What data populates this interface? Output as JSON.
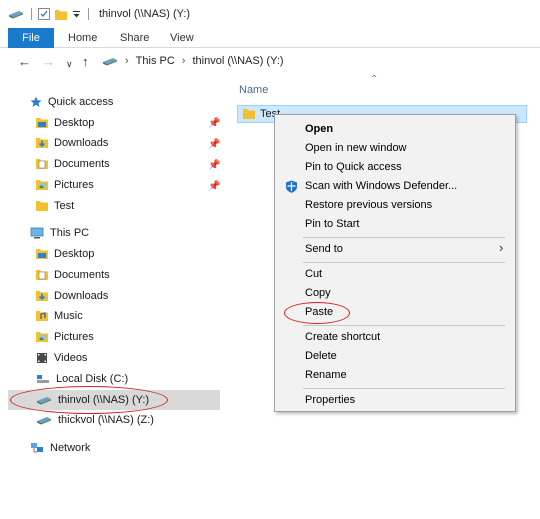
{
  "titlebar": {
    "title": "thinvol (\\\\NAS) (Y:)"
  },
  "ribbon": {
    "tabs": [
      "File",
      "Home",
      "Share",
      "View"
    ]
  },
  "address": {
    "crumbs": [
      "This PC",
      "thinvol (\\\\NAS) (Y:)"
    ]
  },
  "column": {
    "name_header": "Name"
  },
  "sidebar": {
    "quick_access": {
      "label": "Quick access",
      "items": [
        {
          "label": "Desktop",
          "icon": "desktop-folder-icon"
        },
        {
          "label": "Downloads",
          "icon": "downloads-folder-icon"
        },
        {
          "label": "Documents",
          "icon": "documents-folder-icon"
        },
        {
          "label": "Pictures",
          "icon": "pictures-folder-icon"
        },
        {
          "label": "Test",
          "icon": "folder-icon"
        }
      ]
    },
    "this_pc": {
      "label": "This PC",
      "items": [
        {
          "label": "Desktop"
        },
        {
          "label": "Documents"
        },
        {
          "label": "Downloads"
        },
        {
          "label": "Music"
        },
        {
          "label": "Pictures"
        },
        {
          "label": "Videos"
        },
        {
          "label": "Local Disk (C:)"
        },
        {
          "label": "thinvol (\\\\NAS) (Y:)"
        },
        {
          "label": "thickvol (\\\\NAS) (Z:)"
        }
      ]
    },
    "network": {
      "label": "Network"
    }
  },
  "file": {
    "name": "Test"
  },
  "context_menu": {
    "items": [
      "Open",
      "Open in new window",
      "Pin to Quick access",
      "Scan with Windows Defender...",
      "Restore previous versions",
      "Pin to Start",
      "Send to",
      "Cut",
      "Copy",
      "Paste",
      "Create shortcut",
      "Delete",
      "Rename",
      "Properties"
    ]
  },
  "colors": {
    "accent": "#1979ca",
    "selection": "#cce8ff",
    "annotation": "#d21f1f",
    "folder": "#f2c12e"
  }
}
